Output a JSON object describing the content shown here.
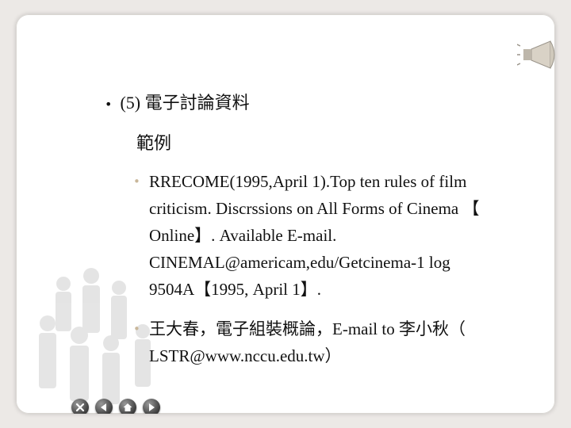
{
  "slide": {
    "bullet_marker": "•",
    "heading": "(5) 電子討論資料",
    "subheading": "範例",
    "items": [
      {
        "marker": "•",
        "lines": [
          "RRECOME(1995,April 1).Top ten rules of film",
          "criticism. Discrssions on All Forms of Cinema 【",
          "Online】. Available E-mail.",
          "CINEMAL@americam,edu/Getcinema-1 log",
          "9504A【1995, April 1】."
        ]
      },
      {
        "marker": "•",
        "lines": [
          "王大春，電子組裝概論，E-mail to 李小秋（",
          "LSTR@www.nccu.edu.tw）"
        ]
      }
    ]
  },
  "navigation": {
    "buttons": [
      "close-icon",
      "back-icon",
      "home-icon",
      "forward-icon"
    ]
  },
  "colors": {
    "bullet_accent": "#c9b79a",
    "background": "#ece9e6"
  }
}
